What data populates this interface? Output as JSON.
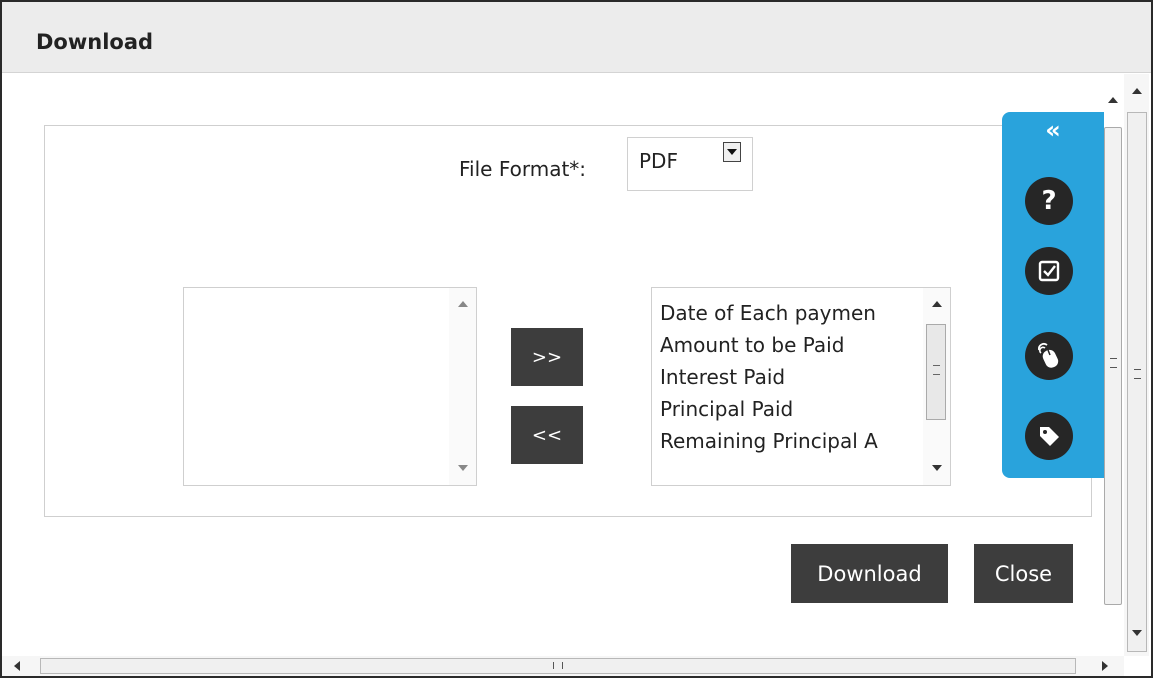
{
  "dialog": {
    "title": "Download"
  },
  "form": {
    "file_format_label": "File Format*:",
    "file_format_value": "PDF"
  },
  "lists": {
    "available_items": [],
    "selected_items": [
      "Date of Each paymen",
      "Amount to be Paid",
      "Interest Paid",
      "Principal Paid",
      "Remaining Principal A"
    ]
  },
  "buttons": {
    "add_label": ">>",
    "remove_label": "<<",
    "download_label": "Download",
    "close_label": "Close"
  },
  "sidebar": {
    "collapse_glyph": "«",
    "icons": [
      "help-icon",
      "checkbox-icon",
      "mouse-click-icon",
      "tag-icon"
    ],
    "help_glyph": "?",
    "accent_color": "#29a3dc"
  },
  "colors": {
    "button_bg": "#3d3d3d",
    "titlebar_bg": "#ececec"
  }
}
